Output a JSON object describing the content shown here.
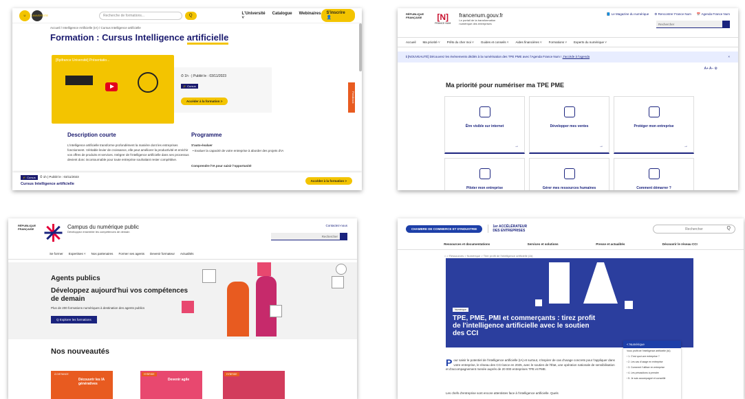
{
  "shot1": {
    "logo": [
      "U",
      "UNIVERSITE"
    ],
    "search_placeholder": "Recherche de formations...",
    "search_icon": "Q",
    "nav": [
      "L'Université ˅",
      "Catalogue",
      "Webinaires"
    ],
    "cta": "S'inscrire 👤",
    "breadcrumb": "Accueil / Intelligence Artificielle (IA) / Cursus Intelligence artificielle",
    "title_main": "Formation : Cursus Intelligence ",
    "title_hl": "artificielle",
    "video_title": "[Bpifrance Université] Présentatio...",
    "meta": "⏱ 1h ·  |  Publié le : 03/11/2023",
    "tag": "🎓 Cursus",
    "access_btn": "Accéder à la formation  >",
    "feedback": "Feedback",
    "desc_title": "Description courte",
    "desc_body": "L'intelligence artificielle transforme profondément la manière dont les entreprises fonctionnent. Véritable levier de croissance, elle peut améliorer la productivité et enrichir vos offres de produits et services. Intégrer de l'intelligence artificielle dans ses processus devient donc incontournable pour toute entreprise souhaitant rester compétitive.",
    "prog_title": "Programme",
    "prog_sub": "S'auto-évaluer",
    "prog_item": "•  Evaluer la capacité de votre entreprise à aborder des projets d'IA",
    "prog_sub2": "Comprendre l'IA pour saisir l'opportunité",
    "bottom_meta": "⏱ 1h  |  Publié le : 03/11/2023",
    "bottom_name": "Cursus Intelligence artificielle"
  },
  "shot2": {
    "rf": "RÉPUBLIQUE FRANÇAISE",
    "fn_mark": "[N]",
    "fn_text": "FRANCE NUM",
    "site_url": "francenum.gouv.fr",
    "site_desc": "Le portail de la transformation numérique des entreprises",
    "links": [
      "📘 Le Magazine du numérique",
      "⚙ Rencontrer France Num",
      "📅 Agenda France Num"
    ],
    "search_placeholder": "Rechercher",
    "menu": [
      "Accueil",
      "Ma priorité ˅",
      "Prêts du cher moi ˅",
      "Guides et conseils ˅",
      "Aides financières ˅",
      "Formations ˅",
      "Experts du numérique ˅"
    ],
    "notice_text": "ℹ  [NOUVEAUTÉ] Découvrez les événements dédiés à la numérisation des TPE PME avec l'Agenda France Num ! ",
    "notice_link": "J'accède à l'agenda",
    "notice_close": "×",
    "sizes": "A+   A–   ⚙",
    "heading": "Ma priorité pour numériser ma TPE PME",
    "cards": [
      "Être visible sur internet",
      "Développer mes ventes",
      "Protéger mon entreprise",
      "Piloter mon entreprise",
      "Gérer mes ressources humaines",
      "Comment démarrer ?"
    ],
    "arrow": "→"
  },
  "shot3": {
    "rf": "RÉPUBLIQUE FRANÇAISE",
    "site_title": "Campus du numérique public",
    "site_desc": "Développez ensemble les compétences de demain",
    "contact": "Contactez-nous",
    "search_placeholder": "Rechercher",
    "menu": [
      "Se former",
      "Expertises ˅",
      "Nos partenaires",
      "Former ses agents",
      "Devenir formateur",
      "Actualités"
    ],
    "hero_title": "Agents publics",
    "hero_sub": "Développez aujourd'hui vos compétences de demain",
    "hero_p": "Plus de 200 formations numériques à destination des agents publics",
    "hero_btn": "Q  Explorer les formations",
    "news": "Nos nouveautés",
    "thumbs": [
      {
        "badge": "À DISTANCE",
        "title": "Découvrir les IA génératives"
      },
      {
        "badge": "HYBRIDE",
        "title": "Devenir agile"
      },
      {
        "badge": "HYBRIDE",
        "title": ""
      }
    ]
  },
  "shot4": {
    "cci": "CHAMBRE DE COMMERCE ET D'INDUSTRIE",
    "acc1": "1er ACCÉLÉRATEUR",
    "acc2": "DES ENTREPRISES",
    "search_placeholder": "Rechercher",
    "menu": [
      "Ressources et documentations",
      "Services et solutions",
      "Presse et actualités",
      "Découvrir le réseau CCI"
    ],
    "breadcrumb": "⌂ > Ressources > Numérique > Tirer profit de l'intelligence artificielle (IA)",
    "hero_big": "IA",
    "hero_tag": "Numérique",
    "hero_title": "TPE, PME, PMI et commerçants : tirez profit de l'intelligence artificielle avec le soutien des CCI",
    "side_head": "<  Numérique",
    "side_items": [
      "Vous profit de l'intelligence artificielle (IA)",
      "› 1. C'est quoi une entreprise ?",
      "› 2. Les cas d'usage en entreprise",
      "› 3. Comment l'utiliser en entreprise",
      "› 4. Les précautions à prendre",
      "› 5. Je suis accompagné et conseillé"
    ],
    "intro_cap": "P",
    "intro": "our saisir le potentiel de l'intelligence artificielle (IA) et surtout, s'inspirer de cas d'usage concrets pour l'appliquer dans votre entreprise, le réseau des CCI lance en 2025, avec le soutien de l'État, une opération nationale de sensibilisation et d'accompagnement menée auprès de 20 000 entreprises TPE et PME.",
    "foot": "Les chefs d'entreprise sont encore attentistes face à l'intelligence artificielle. Quels"
  }
}
